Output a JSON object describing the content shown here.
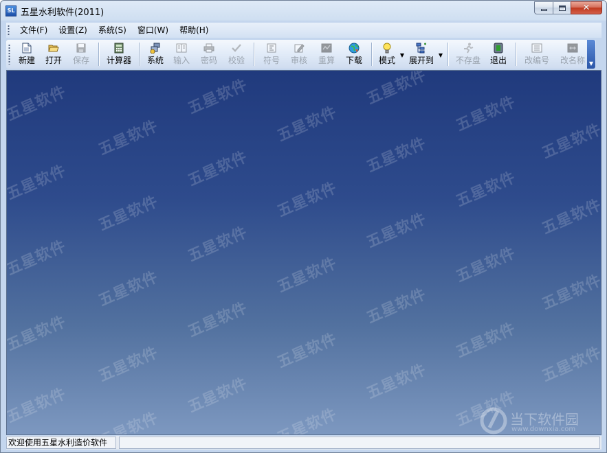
{
  "window": {
    "title": "五星水利软件(2011)",
    "icon_text": "SL"
  },
  "menu": [
    {
      "label": "文件(F)"
    },
    {
      "label": "设置(Z)"
    },
    {
      "label": "系统(S)"
    },
    {
      "label": "窗口(W)"
    },
    {
      "label": "帮助(H)"
    }
  ],
  "toolbar": {
    "buttons": [
      {
        "label": "新建",
        "icon": "new-file-icon",
        "enabled": true
      },
      {
        "label": "打开",
        "icon": "open-folder-icon",
        "enabled": true
      },
      {
        "label": "保存",
        "icon": "save-disk-icon",
        "enabled": false
      },
      {
        "label": "计算器",
        "icon": "calculator-icon",
        "enabled": true
      },
      {
        "label": "系统",
        "icon": "system-icon",
        "enabled": true
      },
      {
        "label": "输入",
        "icon": "input-icon",
        "enabled": false
      },
      {
        "label": "密码",
        "icon": "printer-icon",
        "enabled": false
      },
      {
        "label": "校验",
        "icon": "checkmark-icon",
        "enabled": false
      },
      {
        "label": "符号",
        "icon": "symbol-icon",
        "enabled": false
      },
      {
        "label": "审核",
        "icon": "edit-icon",
        "enabled": false
      },
      {
        "label": "重算",
        "icon": "recalc-icon",
        "enabled": false
      },
      {
        "label": "下载",
        "icon": "download-globe-icon",
        "enabled": true
      },
      {
        "label": "模式",
        "icon": "lightbulb-icon",
        "enabled": true,
        "dropdown": true
      },
      {
        "label": "展开到",
        "icon": "expand-tree-icon",
        "enabled": true,
        "dropdown": true
      },
      {
        "label": "不存盘",
        "icon": "running-man-icon",
        "enabled": false
      },
      {
        "label": "退出",
        "icon": "exit-icon",
        "enabled": true
      },
      {
        "label": "改编号",
        "icon": "renumber-icon",
        "enabled": false
      },
      {
        "label": "改名称",
        "icon": "rename-icon",
        "enabled": false
      }
    ]
  },
  "watermark": {
    "text": "五星软件",
    "footer_logo": "当下软件园",
    "footer_url": "www.downxia.com"
  },
  "statusbar": {
    "message": "欢迎使用五星水利造价软件",
    "secondary": ""
  }
}
